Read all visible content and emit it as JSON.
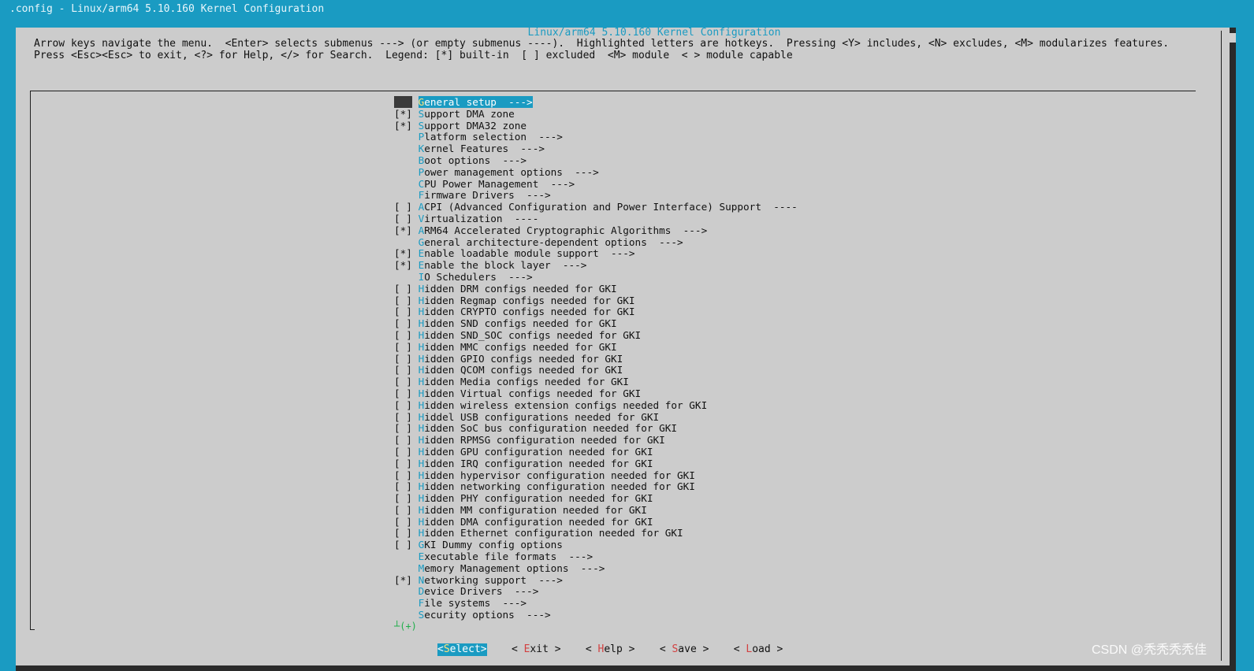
{
  "window": {
    "title": ".config - Linux/arm64 5.10.160 Kernel Configuration"
  },
  "dialog": {
    "title": "Linux/arm64 5.10.160 Kernel Configuration",
    "help_lines": [
      "Arrow keys navigate the menu.  <Enter> selects submenus ---> (or empty submenus ----).  Highlighted letters are hotkeys.  Pressing <Y> includes, <N> excludes, <M> modularizes features.",
      "Press <Esc><Esc> to exit, <?> for Help, </> for Search.  Legend: [*] built-in  [ ] excluded  <M> module  < > module capable"
    ]
  },
  "menu": {
    "selected_index": 0,
    "more_indicator": "┴(+)",
    "items": [
      {
        "prefix": "   ",
        "hotkey": "G",
        "rest": "eneral setup  --->"
      },
      {
        "prefix": "[*]",
        "hotkey": "S",
        "rest": "upport DMA zone"
      },
      {
        "prefix": "[*]",
        "hotkey": "S",
        "rest": "upport DMA32 zone"
      },
      {
        "prefix": "   ",
        "hotkey": "P",
        "rest": "latform selection  --->"
      },
      {
        "prefix": "   ",
        "hotkey": "K",
        "rest": "ernel Features  --->"
      },
      {
        "prefix": "   ",
        "hotkey": "B",
        "rest": "oot options  --->"
      },
      {
        "prefix": "   ",
        "hotkey": "P",
        "rest": "ower management options  --->"
      },
      {
        "prefix": "   ",
        "hotkey": "C",
        "rest": "PU Power Management  --->"
      },
      {
        "prefix": "   ",
        "hotkey": "F",
        "rest": "irmware Drivers  --->"
      },
      {
        "prefix": "[ ]",
        "hotkey": "A",
        "rest": "CPI (Advanced Configuration and Power Interface) Support  ----"
      },
      {
        "prefix": "[ ]",
        "hotkey": "V",
        "rest": "irtualization  ----"
      },
      {
        "prefix": "[*]",
        "hotkey": "A",
        "rest": "RM64 Accelerated Cryptographic Algorithms  --->"
      },
      {
        "prefix": "   ",
        "hotkey": "G",
        "rest": "eneral architecture-dependent options  --->"
      },
      {
        "prefix": "[*]",
        "hotkey": "E",
        "rest": "nable loadable module support  --->"
      },
      {
        "prefix": "[*]",
        "hotkey": "E",
        "rest": "nable the block layer  --->"
      },
      {
        "prefix": "   ",
        "hotkey": "I",
        "rest": "O Schedulers  --->"
      },
      {
        "prefix": "[ ]",
        "hotkey": "H",
        "rest": "idden DRM configs needed for GKI"
      },
      {
        "prefix": "[ ]",
        "hotkey": "H",
        "rest": "idden Regmap configs needed for GKI"
      },
      {
        "prefix": "[ ]",
        "hotkey": "H",
        "rest": "idden CRYPTO configs needed for GKI"
      },
      {
        "prefix": "[ ]",
        "hotkey": "H",
        "rest": "idden SND configs needed for GKI"
      },
      {
        "prefix": "[ ]",
        "hotkey": "H",
        "rest": "idden SND_SOC configs needed for GKI"
      },
      {
        "prefix": "[ ]",
        "hotkey": "H",
        "rest": "idden MMC configs needed for GKI"
      },
      {
        "prefix": "[ ]",
        "hotkey": "H",
        "rest": "idden GPIO configs needed for GKI"
      },
      {
        "prefix": "[ ]",
        "hotkey": "H",
        "rest": "idden QCOM configs needed for GKI"
      },
      {
        "prefix": "[ ]",
        "hotkey": "H",
        "rest": "idden Media configs needed for GKI"
      },
      {
        "prefix": "[ ]",
        "hotkey": "H",
        "rest": "idden Virtual configs needed for GKI"
      },
      {
        "prefix": "[ ]",
        "hotkey": "H",
        "rest": "idden wireless extension configs needed for GKI"
      },
      {
        "prefix": "[ ]",
        "hotkey": "H",
        "rest": "iddel USB configurations needed for GKI"
      },
      {
        "prefix": "[ ]",
        "hotkey": "H",
        "rest": "idden SoC bus configuration needed for GKI"
      },
      {
        "prefix": "[ ]",
        "hotkey": "H",
        "rest": "idden RPMSG configuration needed for GKI"
      },
      {
        "prefix": "[ ]",
        "hotkey": "H",
        "rest": "idden GPU configuration needed for GKI"
      },
      {
        "prefix": "[ ]",
        "hotkey": "H",
        "rest": "idden IRQ configuration needed for GKI"
      },
      {
        "prefix": "[ ]",
        "hotkey": "H",
        "rest": "idden hypervisor configuration needed for GKI"
      },
      {
        "prefix": "[ ]",
        "hotkey": "H",
        "rest": "idden networking configuration needed for GKI"
      },
      {
        "prefix": "[ ]",
        "hotkey": "H",
        "rest": "idden PHY configuration needed for GKI"
      },
      {
        "prefix": "[ ]",
        "hotkey": "H",
        "rest": "idden MM configuration needed for GKI"
      },
      {
        "prefix": "[ ]",
        "hotkey": "H",
        "rest": "idden DMA configuration needed for GKI"
      },
      {
        "prefix": "[ ]",
        "hotkey": "H",
        "rest": "idden Ethernet configuration needed for GKI"
      },
      {
        "prefix": "[ ]",
        "hotkey": "G",
        "rest": "KI Dummy config options"
      },
      {
        "prefix": "   ",
        "hotkey": "E",
        "rest": "xecutable file formats  --->"
      },
      {
        "prefix": "   ",
        "hotkey": "M",
        "rest": "emory Management options  --->"
      },
      {
        "prefix": "[*]",
        "hotkey": "N",
        "rest": "etworking support  --->"
      },
      {
        "prefix": "   ",
        "hotkey": "D",
        "rest": "evice Drivers  --->"
      },
      {
        "prefix": "   ",
        "hotkey": "F",
        "rest": "ile systems  --->"
      },
      {
        "prefix": "   ",
        "hotkey": "S",
        "rest": "ecurity options  --->"
      }
    ]
  },
  "buttons": [
    {
      "name": "select",
      "open": "<",
      "hotkey": "S",
      "rest": "elect>",
      "active": true
    },
    {
      "name": "exit",
      "open": "< ",
      "hotkey": "E",
      "rest": "xit >",
      "active": false
    },
    {
      "name": "help",
      "open": "< ",
      "hotkey": "H",
      "rest": "elp >",
      "active": false
    },
    {
      "name": "save",
      "open": "< ",
      "hotkey": "S",
      "rest": "ave >",
      "active": false
    },
    {
      "name": "load",
      "open": "< ",
      "hotkey": "L",
      "rest": "oad >",
      "active": false
    }
  ],
  "watermark": "CSDN @秃秃秃秃佳",
  "colors": {
    "terminal_bg": "#1a9bc2",
    "dialog_bg": "#cccccc",
    "hotkey": "#1a9bc2",
    "selected_hotkey": "#ffe27a",
    "button_hotkey": "#d24040"
  }
}
